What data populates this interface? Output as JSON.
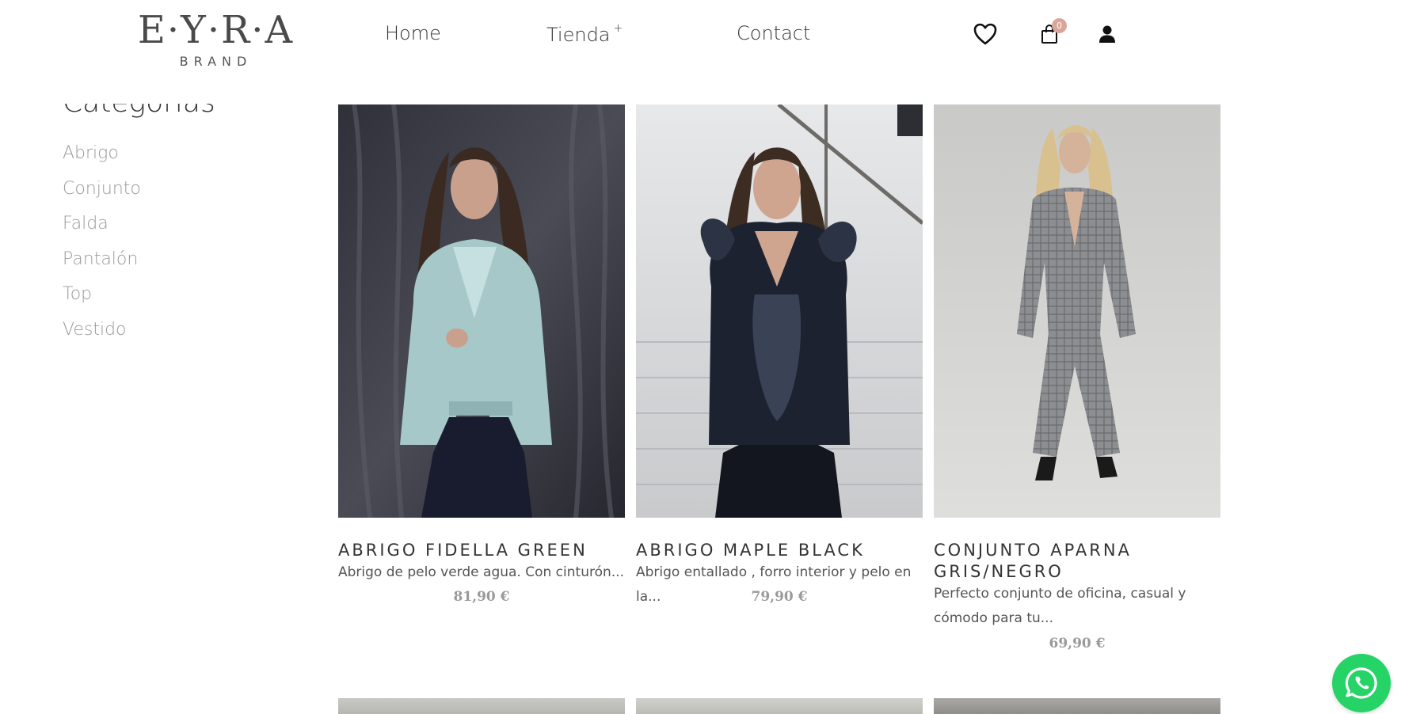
{
  "brand": {
    "logo_main": "E·Y·R·A",
    "logo_sub": "BRAND"
  },
  "nav": {
    "home": "Home",
    "tienda": "Tienda",
    "tienda_suffix": "+",
    "contact": "Contact"
  },
  "header_icons": {
    "wishlist": "heart-icon",
    "cart": "shopping-bag-icon",
    "user": "user-icon",
    "cart_count": "0"
  },
  "sidebar": {
    "title": "Categorías",
    "categories": [
      "Abrigo",
      "Conjunto",
      "Falda",
      "Pantalón",
      "Top",
      "Vestido"
    ]
  },
  "products": [
    {
      "name": "ABRIGO FIDELLA GREEN",
      "description": "Abrigo de pelo verde agua. Con cinturón...",
      "price": "81,90 €"
    },
    {
      "name": "ABRIGO MAPLE BLACK",
      "description": "Abrigo entallado , forro interior y pelo en la...",
      "price": "79,90 €"
    },
    {
      "name": "CONJUNTO APARNA GRIS/NEGRO",
      "description": "Perfecto conjunto de oficina, casual y cómodo para tu...",
      "price": "69,90 €"
    }
  ],
  "colors": {
    "accent": "#d9a69a",
    "whatsapp": "#25d366",
    "price": "#9a9a9a"
  },
  "chat_button": "whatsapp-icon"
}
